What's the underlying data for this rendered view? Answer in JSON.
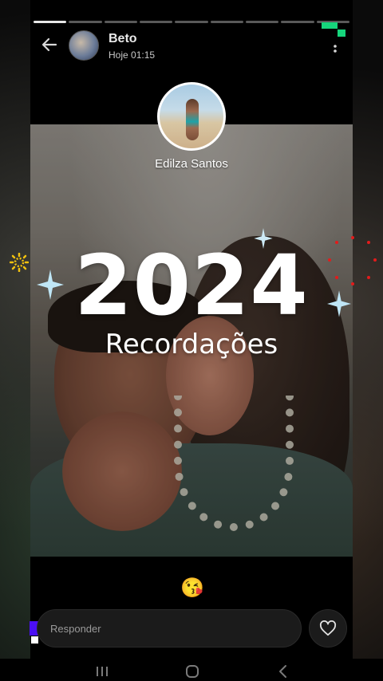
{
  "header": {
    "sender_name": "Beto",
    "timestamp": "Hoje 01:15",
    "back_icon": "arrow-left-icon",
    "menu_icon": "more-vertical-icon"
  },
  "progress": {
    "segments": 9,
    "completed": 1
  },
  "tagged_profile": {
    "name": "Edilza Santos"
  },
  "story": {
    "title": "2024",
    "subtitle": "Recordações"
  },
  "reaction": {
    "emoji": "😘"
  },
  "reply": {
    "placeholder": "Responder",
    "like_icon": "heart-icon"
  },
  "system_nav": {
    "recents_icon": "recents-icon",
    "home_icon": "home-icon",
    "back_icon": "back-icon"
  },
  "colors": {
    "status_green": "#16d57c",
    "accent_purple": "#4b0ff5",
    "sparkle_red": "#e31b1b"
  }
}
